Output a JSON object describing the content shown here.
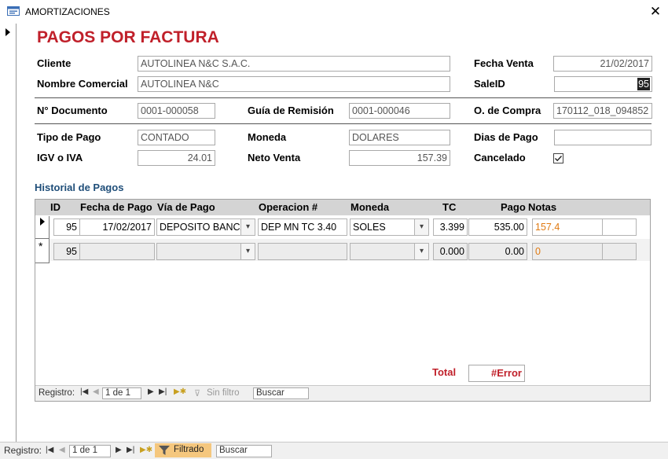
{
  "window": {
    "title": "AMORTIZACIONES",
    "close_label": "✕"
  },
  "form": {
    "heading": "PAGOS POR FACTURA",
    "labels": {
      "cliente": "Cliente",
      "nombre_comercial": "Nombre Comercial",
      "fecha_venta": "Fecha Venta",
      "sale_id": "SaleID",
      "n_documento": "N° Documento",
      "guia_remision": "Guía de Remisión",
      "o_compra": "O. de Compra",
      "tipo_pago": "Tipo de Pago",
      "moneda": "Moneda",
      "dias_pago": "Dias de Pago",
      "igv": "IGV o IVA",
      "neto_venta": "Neto Venta",
      "cancelado": "Cancelado"
    },
    "values": {
      "cliente": "AUTOLINEA N&C S.A.C.",
      "nombre_comercial": "AUTOLINEA N&C",
      "fecha_venta": "21/02/2017",
      "sale_id": "95",
      "n_documento": "0001-000058",
      "guia_remision": "0001-000046",
      "o_compra": "170112_018_094852",
      "tipo_pago": "CONTADO",
      "moneda": "DOLARES",
      "dias_pago": "",
      "igv": "24.01",
      "neto_venta": "157.39",
      "cancelado": true
    }
  },
  "historial": {
    "title": "Historial de Pagos",
    "columns": [
      "ID",
      "Fecha de Pago",
      "Vía de Pago",
      "Operacion #",
      "Moneda",
      "TC",
      "Pago",
      "Notas"
    ],
    "rows": [
      {
        "id": "95",
        "fecha": "17/02/2017",
        "via": "DEPOSITO BANCA",
        "operacion": "DEP MN TC 3.40",
        "moneda": "SOLES",
        "tc": "3.399",
        "pago": "535.00",
        "notas": "157.4"
      },
      {
        "id": "95",
        "fecha": "",
        "via": "",
        "operacion": "",
        "moneda": "",
        "tc": "0.000",
        "pago": "0.00",
        "notas": "0"
      }
    ],
    "total_label": "Total",
    "total_value": "#Error",
    "nav": {
      "registro_label": "Registro:",
      "position": "1 de 1",
      "filter_label": "Sin filtro",
      "search_placeholder": "Buscar"
    }
  },
  "main_nav": {
    "registro_label": "Registro:",
    "position": "1 de 1",
    "filter_label": "Filtrado",
    "search_placeholder": "Buscar"
  },
  "colors": {
    "heading": "#c0202a",
    "section_title": "#1f4e79",
    "notes": "#e07a12",
    "filter_active": "#f5c77e"
  },
  "icons": {
    "window": "form-icon",
    "close": "close-icon",
    "record_selector": "record-pointer-icon",
    "new_record": "asterisk-icon",
    "filter": "funnel-icon"
  }
}
